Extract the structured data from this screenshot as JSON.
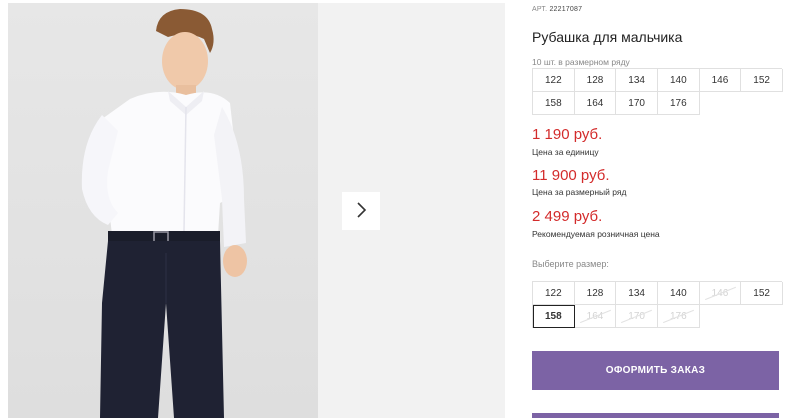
{
  "product": {
    "article_label": "АРТ.",
    "article_number": "22217087",
    "title": "Рубашка для мальчика",
    "row_note": "10 шт. в размерном ряду"
  },
  "size_row": [
    {
      "label": "122"
    },
    {
      "label": "128"
    },
    {
      "label": "134"
    },
    {
      "label": "140"
    },
    {
      "label": "146"
    },
    {
      "label": "152"
    },
    {
      "label": "158"
    },
    {
      "label": "164"
    },
    {
      "label": "170"
    },
    {
      "label": "176"
    }
  ],
  "prices": {
    "unit_price": "1 190 руб.",
    "unit_label": "Цена за единицу",
    "row_price": "11 900 руб.",
    "row_label": "Цена за размерный ряд",
    "retail_price": "2 499 руб.",
    "retail_label": "Рекомендуемая розничная цена"
  },
  "size_picker": {
    "label": "Выберите размер:",
    "selected": "158",
    "options": [
      {
        "label": "122",
        "available": true
      },
      {
        "label": "128",
        "available": true
      },
      {
        "label": "134",
        "available": true
      },
      {
        "label": "140",
        "available": true
      },
      {
        "label": "146",
        "available": false
      },
      {
        "label": "152",
        "available": true
      },
      {
        "label": "158",
        "available": true
      },
      {
        "label": "164",
        "available": false
      },
      {
        "label": "170",
        "available": false
      },
      {
        "label": "176",
        "available": false
      }
    ]
  },
  "actions": {
    "order_label": "ОФОРМИТЬ ЗАКАЗ"
  },
  "colors": {
    "price": "#d32b2b",
    "accent": "#7c63a5"
  },
  "icons": {
    "next": "chevron-right-icon"
  }
}
